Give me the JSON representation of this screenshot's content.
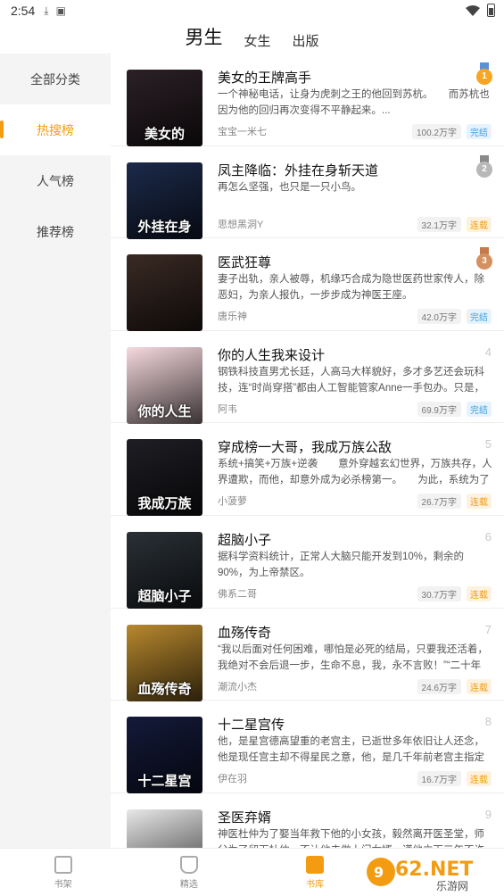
{
  "status_bar": {
    "time": "2:54"
  },
  "top_tabs": [
    "男生",
    "女生",
    "出版"
  ],
  "sidebar": {
    "items": [
      {
        "label": "全部分类"
      },
      {
        "label": "热搜榜"
      },
      {
        "label": "人气榜"
      },
      {
        "label": "推荐榜"
      }
    ]
  },
  "books": [
    {
      "title": "美女的王牌高手",
      "desc": "一个神秘电话，让身为虎刺之王的他回到苏杭。　　而苏杭也因为他的回归再次变得不平静起来。...",
      "author": "宝宝一米七",
      "count": "100.2万字",
      "status": "完结",
      "rank": "1",
      "cover_text": "美女的",
      "cover_color": "#2b2026"
    },
    {
      "title": "凤主降临：外挂在身斩天道",
      "desc": "再怎么坚强，也只是一只小鸟。",
      "author": "思想黑洞Y",
      "count": "32.1万字",
      "status": "连载",
      "rank": "2",
      "cover_text": "外挂在身",
      "cover_color": "#1c2a4a"
    },
    {
      "title": "医武狂尊",
      "desc": "妻子出轨，亲人被辱，机缘巧合成为隐世医药世家传人，除恶妇，为亲人报仇，一步步成为神医王座。",
      "author": "唐乐神",
      "count": "42.0万字",
      "status": "完结",
      "rank": "3",
      "cover_text": "",
      "cover_color": "#3a2a24"
    },
    {
      "title": "你的人生我来设计",
      "desc": "钢铁科技直男尤长廷，人高马大样貌好，多才多艺还会玩科技，连“时尚穿搭”都由人工智能管家Anne一手包办。只是，Anne最...",
      "author": "阿韦",
      "count": "69.9万字",
      "status": "完结",
      "rank": "4",
      "cover_text": "你的人生",
      "cover_color": "#f6d9de"
    },
    {
      "title": "穿成榜一大哥，我成万族公敌",
      "desc": "系统+搞笑+万族+逆袭　　意外穿越玄幻世界，万族共存，人界遭欺，而他，却意外成为必杀榜第一。　　为此，系统为了让他活...",
      "author": "小菠萝",
      "count": "26.7万字",
      "status": "连载",
      "rank": "5",
      "cover_text": "我成万族",
      "cover_color": "#1e1e24"
    },
    {
      "title": "超脑小子",
      "desc": "据科学资料统计，正常人大脑只能开发到10%，剩余的90%，为上帝禁区。",
      "author": "佛系二哥",
      "count": "30.7万字",
      "status": "连载",
      "rank": "6",
      "cover_text": "超脑小子",
      "cover_color": "#2a3036"
    },
    {
      "title": "血殇传奇",
      "desc": "“我以后面对任何困难，哪怕是必死的结局，只要我还活着，我绝对不会后退一步，生命不息，我，永不言败！”“二十年东，二十...",
      "author": "潮流小杰",
      "count": "24.6万字",
      "status": "连载",
      "rank": "7",
      "cover_text": "血殇传奇",
      "cover_color": "#b8892e"
    },
    {
      "title": "十二星宫传",
      "desc": "他，是星宫德高望重的老宫主，已逝世多年依旧让人还念，他是现任宫主却不得星民之意，他，是几千年前老宫主指定的凡人，...",
      "author": "伊在羽",
      "count": "16.7万字",
      "status": "连载",
      "rank": "8",
      "cover_text": "十二星宫",
      "cover_color": "#141a3a"
    },
    {
      "title": "圣医弃婿",
      "desc": "神医杜仲为了娶当年救下他的小女孩，毅然离开医圣堂，师父为了留下杜仲，不让他去做上门女婿，谎他立下三年不许行医的誓",
      "author": "",
      "count": "",
      "status": "",
      "rank": "9",
      "cover_text": "",
      "cover_color": "#e8e8e8"
    }
  ],
  "bottom_nav": [
    "书架",
    "精选",
    "书库"
  ],
  "watermark": "962.NET 乐游网",
  "colors": {
    "accent": "#f39c12",
    "done": "#3aa0e0"
  }
}
